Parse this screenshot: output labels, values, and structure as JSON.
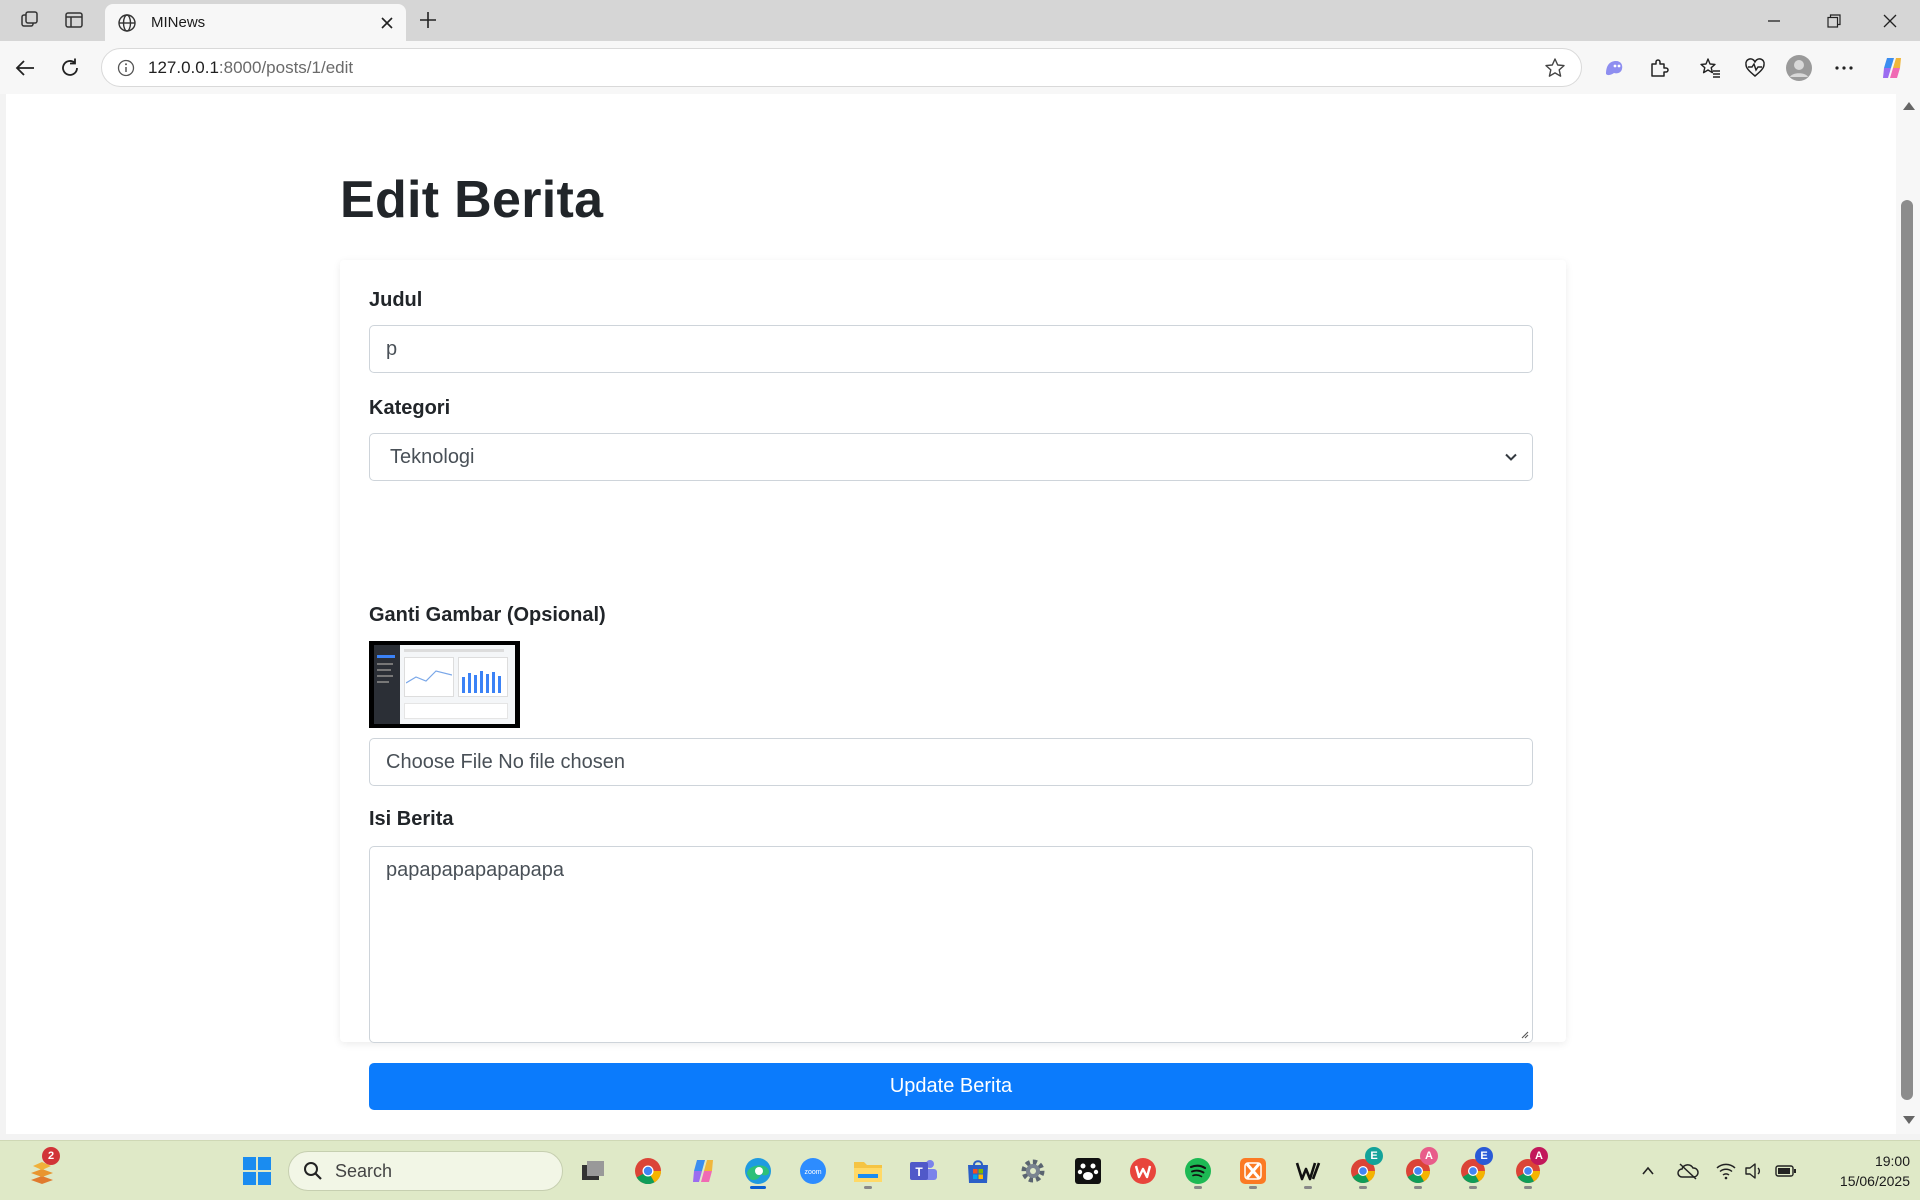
{
  "browser": {
    "tab_title": "MINews",
    "url_host": "127.0.0.1",
    "url_rest": ":8000/posts/1/edit"
  },
  "page": {
    "title": "Edit Berita",
    "form": {
      "judul_label": "Judul",
      "judul_value": "p",
      "kategori_label": "Kategori",
      "kategori_value": "Teknologi",
      "gambar_label": "Ganti Gambar (Opsional)",
      "file_input_text": "Choose File No file chosen",
      "isi_label": "Isi Berita",
      "isi_value": "papapapapapapapa",
      "submit_label": "Update Berita"
    }
  },
  "taskbar": {
    "search_placeholder": "Search",
    "widget_badge": "2",
    "time": "19:00",
    "date": "15/06/2025",
    "profile_badges": [
      "E",
      "A",
      "E",
      "A"
    ]
  },
  "colors": {
    "primary": "#0b7bfc",
    "browser_frame": "#d6d6d6",
    "taskbar": "#dfe9c7"
  }
}
